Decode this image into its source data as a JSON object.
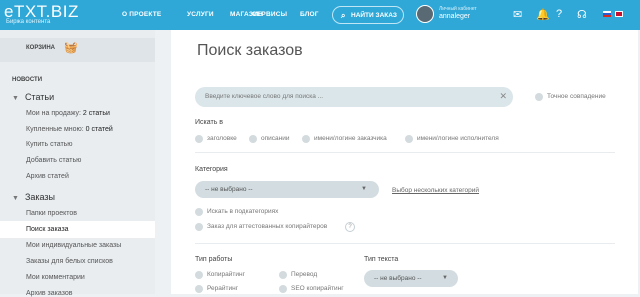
{
  "header": {
    "logo": "eTXT.BIZ",
    "logo_sub": "Биржа контента",
    "nav": [
      "О ПРОЕКТЕ",
      "УСЛУГИ",
      "МАГАЗИН",
      "СЕРВИСЫ",
      "БЛОГ"
    ],
    "search_label": "НАЙТИ ЗАКАЗ",
    "account_label": "Личный кабинет",
    "account_name": "annaleger"
  },
  "sidebar": {
    "cart": "КОРЗИНА",
    "news": "НОВОСТИ",
    "articles_head": "Статьи",
    "articles": [
      {
        "label": "Мои на продажу:",
        "value": "2 статьи"
      },
      {
        "label": "Купленные мною:",
        "value": "0 статей"
      },
      {
        "label": "Купить статью",
        "value": ""
      },
      {
        "label": "Добавить статью",
        "value": ""
      },
      {
        "label": "Архив статей",
        "value": ""
      }
    ],
    "orders_head": "Заказы",
    "orders": [
      "Папки проектов",
      "Поиск заказа",
      "Мои индивидуальные заказы",
      "Заказы для белых списков",
      "Мои комментарии",
      "Архив заказов"
    ]
  },
  "main": {
    "title": "Поиск заказов",
    "search_placeholder": "Введите ключевое слово для поиска ...",
    "exact_match": "Точное совпадение",
    "search_in": "Искать в",
    "search_in_opts": [
      "заголовке",
      "описании",
      "имени/логине заказчика",
      "имени/логине исполнителя"
    ],
    "category": "Категория",
    "category_value": "-- не выбрано --",
    "multi_cat_link": "Выбор нескольких категорий",
    "subcat": "Искать в подкатегориях",
    "attested": "Заказ для аттестованных копирайтеров",
    "help": "?",
    "work_type": "Тип работы",
    "work_opts": [
      "Копирайтинг",
      "Перевод",
      "Рерайтинг",
      "SEO копирайтинг"
    ],
    "text_type": "Тип текста",
    "text_type_value": "-- не выбрано --"
  }
}
